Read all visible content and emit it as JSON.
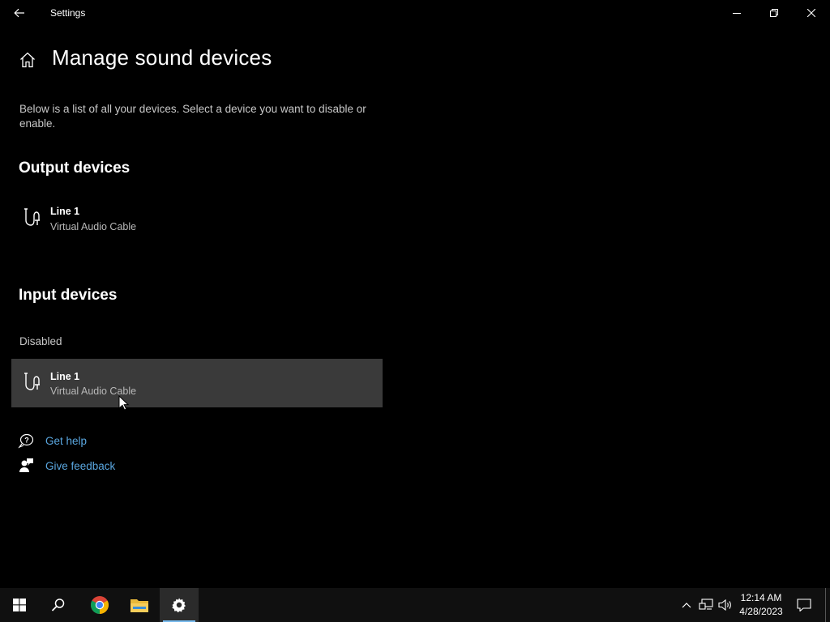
{
  "window": {
    "title": "Settings"
  },
  "page": {
    "title": "Manage sound devices",
    "description": "Below is a list of all your devices. Select a device you want to disable or enable."
  },
  "output": {
    "heading": "Output devices",
    "devices": [
      {
        "name": "Line 1",
        "subtitle": "Virtual Audio Cable"
      }
    ]
  },
  "input": {
    "heading": "Input devices",
    "status": "Disabled",
    "devices": [
      {
        "name": "Line 1",
        "subtitle": "Virtual Audio Cable"
      }
    ]
  },
  "links": {
    "help": "Get help",
    "feedback": "Give feedback"
  },
  "taskbar": {
    "time": "12:14 AM",
    "date": "4/28/2023",
    "active_app": "settings-icon"
  },
  "colors": {
    "background": "#000000",
    "selected_row": "#3a3a3a",
    "link": "#5aa7e0",
    "taskbar": "#101010",
    "accent": "#76b9ed"
  }
}
